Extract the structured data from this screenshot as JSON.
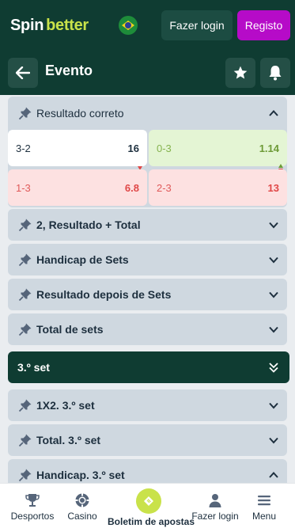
{
  "header": {
    "logo_spin": "Spin",
    "logo_better": "better",
    "login_label": "Fazer login",
    "register_label": "Registo"
  },
  "event_bar": {
    "title": "Evento"
  },
  "open_market": {
    "title": "Resultado correto",
    "odds": [
      {
        "name": "3-2",
        "value": "16",
        "state": "normal"
      },
      {
        "name": "0-3",
        "value": "1.14",
        "state": "up"
      },
      {
        "name": "1-3",
        "value": "6.8",
        "state": "down"
      },
      {
        "name": "2-3",
        "value": "13",
        "state": "down"
      }
    ]
  },
  "markets": [
    {
      "title": "2, Resultado + Total"
    },
    {
      "title": "Handicap de Sets"
    },
    {
      "title": "Resultado depois de Sets"
    },
    {
      "title": "Total de sets"
    }
  ],
  "section": {
    "title": "3.º set"
  },
  "set_markets": [
    {
      "title": "1X2. 3.º set"
    },
    {
      "title": "Total. 3.º set"
    },
    {
      "title": "Handicap. 3.º set"
    }
  ],
  "bottom_nav": {
    "sports": "Desportos",
    "casino": "Casino",
    "betslip": "Boletim de apostas",
    "login": "Fazer login",
    "menu": "Menu"
  },
  "colors": {
    "brand_dark": "#0f3c32",
    "accent_lime": "#c9e24a",
    "register_purple": "#b60bc8",
    "odd_up_bg": "#e4f5d4",
    "odd_down_bg": "#fde1e1"
  }
}
